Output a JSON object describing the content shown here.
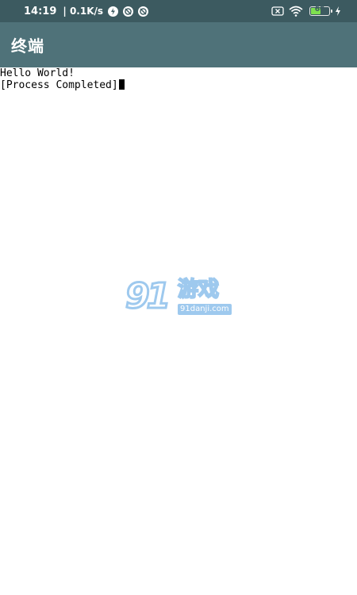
{
  "status_bar": {
    "time": "14:19",
    "net_speed": "| 0.1K/s",
    "battery_level": "60",
    "battery_fraction": 0.6,
    "icons": [
      "lightning-icon",
      "sync-icon",
      "sync-icon",
      "sim-off-icon",
      "wifi-icon",
      "battery-icon",
      "charging-bolt-icon"
    ]
  },
  "app_bar": {
    "title": "终端"
  },
  "terminal": {
    "lines": [
      "Hello World!",
      "[Process Completed]"
    ]
  },
  "watermark": {
    "logo_number": "91",
    "logo_text": "游戏",
    "domain": "91danji.com"
  },
  "colors": {
    "status_bar_bg": "#3c5a60",
    "app_bar_bg": "#4f7279",
    "terminal_bg": "#ffffff",
    "terminal_text": "#000000",
    "battery_fill": "#7ee04f",
    "watermark_blue": "#8ec0ec"
  }
}
